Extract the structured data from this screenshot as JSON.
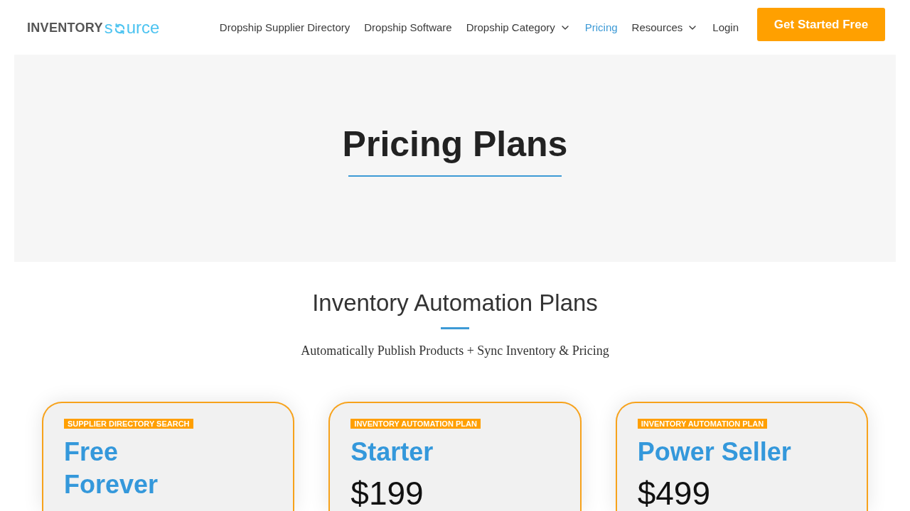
{
  "header": {
    "logo": {
      "text_1": "INVENTORY",
      "text_2": "s",
      "text_3": "urce"
    },
    "nav": [
      {
        "label": "Dropship Supplier Directory",
        "selected": false,
        "dropdown": false
      },
      {
        "label": "Dropship Software",
        "selected": false,
        "dropdown": false
      },
      {
        "label": "Dropship Category",
        "selected": false,
        "dropdown": true
      },
      {
        "label": "Pricing",
        "selected": true,
        "dropdown": false
      },
      {
        "label": "Resources",
        "selected": false,
        "dropdown": true
      },
      {
        "label": "Login",
        "selected": false,
        "dropdown": false
      }
    ],
    "cta_button": "Get Started Free"
  },
  "hero": {
    "title": "Pricing Plans"
  },
  "plans_section": {
    "title": "Inventory Automation Plans",
    "subtitle": "Automatically Publish Products + Sync Inventory & Pricing",
    "plans": [
      {
        "badge": "SUPPLIER DIRECTORY SEARCH",
        "name": "Free\nForever"
      },
      {
        "badge": "INVENTORY AUTOMATION PLAN",
        "name": "Starter",
        "price": "$199"
      },
      {
        "badge": "INVENTORY AUTOMATION PLAN",
        "name": "Power Seller",
        "price": "$499"
      }
    ]
  }
}
